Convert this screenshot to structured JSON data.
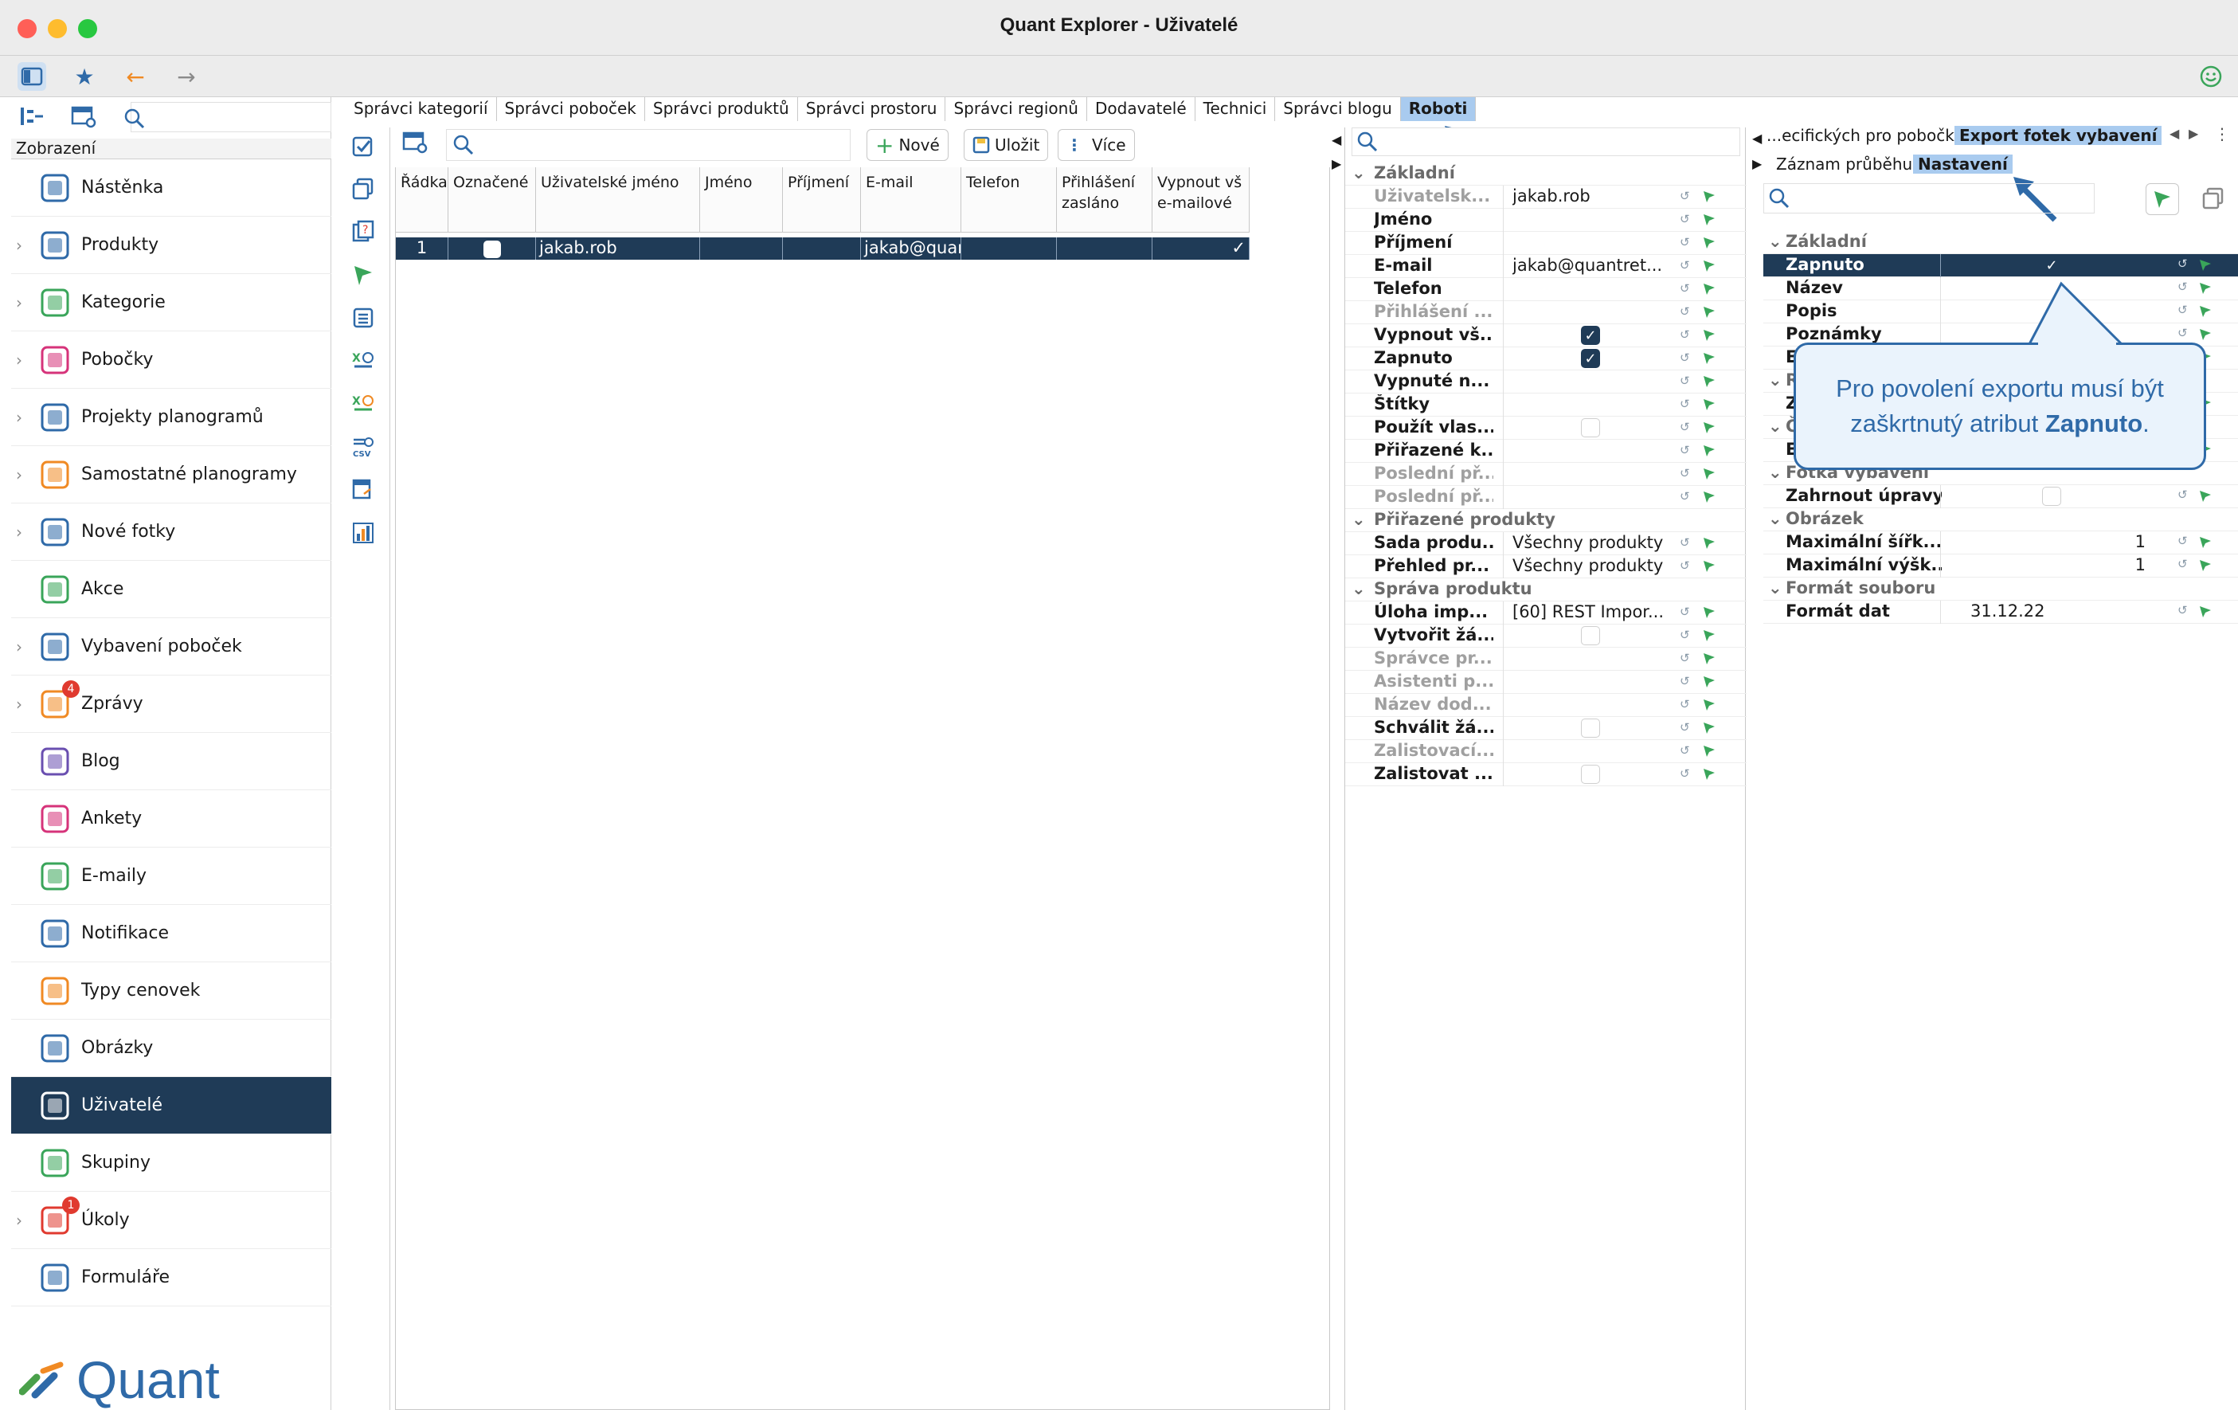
{
  "window": {
    "title": "Quant Explorer - Uživatelé"
  },
  "sidebar": {
    "header": "Zobrazení",
    "items": [
      {
        "label": "Nástěnka",
        "has_children": false
      },
      {
        "label": "Produkty",
        "has_children": true
      },
      {
        "label": "Kategorie",
        "has_children": true
      },
      {
        "label": "Pobočky",
        "has_children": true
      },
      {
        "label": "Projekty planogramů",
        "has_children": true
      },
      {
        "label": "Samostatné planogramy",
        "has_children": true
      },
      {
        "label": "Nové fotky",
        "has_children": true
      },
      {
        "label": "Akce",
        "has_children": false
      },
      {
        "label": "Vybavení poboček",
        "has_children": true
      },
      {
        "label": "Zprávy",
        "has_children": true,
        "badge": "4"
      },
      {
        "label": "Blog",
        "has_children": false
      },
      {
        "label": "Ankety",
        "has_children": false
      },
      {
        "label": "E-maily",
        "has_children": false
      },
      {
        "label": "Notifikace",
        "has_children": false
      },
      {
        "label": "Typy cenovek",
        "has_children": false
      },
      {
        "label": "Obrázky",
        "has_children": false
      },
      {
        "label": "Uživatelé",
        "has_children": false,
        "active": true
      },
      {
        "label": "Skupiny",
        "has_children": false
      },
      {
        "label": "Úkoly",
        "has_children": true,
        "badge": "1"
      },
      {
        "label": "Formuláře",
        "has_children": false
      }
    ],
    "brand": "Quant"
  },
  "tabs": [
    "Správci kategorií",
    "Správci poboček",
    "Správci produktů",
    "Správci prostoru",
    "Správci regionů",
    "Dodavatelé",
    "Technici",
    "Správci blogu",
    "Roboti"
  ],
  "active_tab": "Roboti",
  "grid_toolbar": {
    "new_label": "Nové",
    "save_label": "Uložit",
    "more_label": "Více"
  },
  "grid": {
    "columns": [
      "Řádka",
      "Označené",
      "Uživatelské jméno",
      "Jméno",
      "Příjmení",
      "E-mail",
      "Telefon",
      "Přihlášení zasláno",
      "Vypnout vš e-mailové"
    ],
    "rows": [
      {
        "row": "1",
        "checked": false,
        "username": "jakab.rob",
        "first": "",
        "last": "",
        "email": "jakab@quantret...",
        "phone": "",
        "sent": "",
        "disable_all": true
      }
    ]
  },
  "properties": {
    "sections": [
      {
        "title": "Základní",
        "rows": [
          {
            "key": "Uživatelsk...",
            "value": "jakab.rob",
            "dim": true
          },
          {
            "key": "Jméno",
            "value": ""
          },
          {
            "key": "Příjmení",
            "value": ""
          },
          {
            "key": "E-mail",
            "value": "jakab@quantret..."
          },
          {
            "key": "Telefon",
            "value": ""
          },
          {
            "key": "Přihlášení ...",
            "value": "",
            "dim": true
          },
          {
            "key": "Vypnout vš...",
            "checkbox": true
          },
          {
            "key": "Zapnuto",
            "checkbox": true
          },
          {
            "key": "Vypnuté n...",
            "value": ""
          },
          {
            "key": "Štítky",
            "value": ""
          },
          {
            "key": "Použít vlas...",
            "checkbox": false
          },
          {
            "key": "Přiřazené k...",
            "value": ""
          },
          {
            "key": "Poslední př...",
            "value": "",
            "dim": true
          },
          {
            "key": "Poslední př...",
            "value": "",
            "dim": true
          }
        ]
      },
      {
        "title": "Přiřazené produkty",
        "rows": [
          {
            "key": "Sada produ...",
            "value": "Všechny produkty"
          },
          {
            "key": "Přehled pr...",
            "value": "Všechny produkty"
          }
        ]
      },
      {
        "title": "Správa produktu",
        "rows": [
          {
            "key": "Úloha imp...",
            "value": "[60] REST Impor..."
          },
          {
            "key": "Vytvořit žá...",
            "checkbox": false
          },
          {
            "key": "Správce pr...",
            "value": "",
            "dim": true
          },
          {
            "key": "Asistenti p...",
            "value": "",
            "dim": true
          },
          {
            "key": "Název dod...",
            "value": "",
            "dim": true
          },
          {
            "key": "Schválit žá...",
            "checkbox": false
          },
          {
            "key": "Zalistovací...",
            "value": "",
            "dim": true
          },
          {
            "key": "Zalistovat ...",
            "checkbox": false
          }
        ]
      }
    ]
  },
  "right_panel": {
    "top_tabs": [
      "...ecifických pro pobočku",
      "Export fotek vybavení"
    ],
    "sub_tabs": [
      "Záznam průběhu",
      "Nastavení"
    ],
    "active_sub_tab": "Nastavení",
    "sections": [
      {
        "title": "Základní",
        "rows": [
          {
            "key": "Zapnuto",
            "checkbox": true,
            "selected": true
          },
          {
            "key": "Název",
            "value": ""
          },
          {
            "key": "Popis",
            "value": ""
          },
          {
            "key": "Poznámky",
            "value": ""
          },
          {
            "key": "E",
            "value": ""
          }
        ]
      },
      {
        "title": "R",
        "rows": [
          {
            "key": "Z",
            "value": ""
          }
        ]
      },
      {
        "title": "Č",
        "rows": [
          {
            "key": "E",
            "value": ""
          }
        ]
      },
      {
        "title": "Fotka vybavení",
        "rows": [
          {
            "key": "Zahrnout úpravy",
            "checkbox": false
          }
        ]
      },
      {
        "title": "Obrázek",
        "rows": [
          {
            "key": "Maximální šířk...",
            "value": "1"
          },
          {
            "key": "Maximální výšk...",
            "value": "1"
          }
        ]
      },
      {
        "title": "Formát souboru",
        "rows": [
          {
            "key": "Formát dat",
            "value": "31.12.22"
          }
        ]
      }
    ]
  },
  "callout": {
    "text_before": "Pro povolení exportu musí být zaškrtnutý atribut ",
    "text_bold": "Zapnuto",
    "text_after": "."
  },
  "colors": {
    "selection": "#1f3b57",
    "accent": "#2f6aa8",
    "active_tab": "#a9cbef",
    "badge": "#e03a2f"
  }
}
